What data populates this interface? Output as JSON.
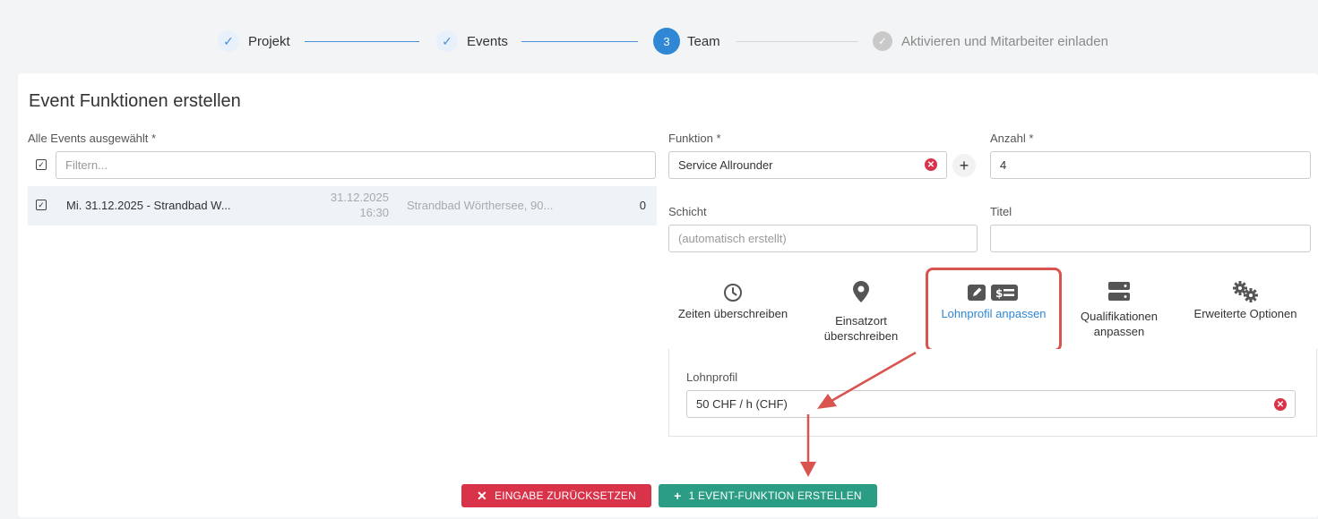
{
  "stepper": {
    "steps": [
      {
        "label": "Projekt",
        "state": "done"
      },
      {
        "label": "Events",
        "state": "done"
      },
      {
        "label": "Team",
        "state": "active",
        "number": "3"
      },
      {
        "label": "Aktivieren und Mitarbeiter einladen",
        "state": "pending"
      }
    ]
  },
  "form": {
    "title": "Event Funktionen erstellen",
    "events_label": "Alle Events ausgewählt *",
    "filter_placeholder": "Filtern...",
    "event_row": {
      "name": "Mi. 31.12.2025 - Strandbad W...",
      "date": "31.12.2025",
      "time": "16:30",
      "location": "Strandbad Wörthersee, 90...",
      "count": "0"
    },
    "funktion_label": "Funktion *",
    "funktion_value": "Service Allrounder",
    "anzahl_label": "Anzahl *",
    "anzahl_value": "4",
    "schicht_label": "Schicht",
    "schicht_placeholder": "(automatisch erstellt)",
    "titel_label": "Titel",
    "titel_value": ""
  },
  "tabs": [
    {
      "line1": "Zeiten überschreiben",
      "line2": "",
      "icon": "clock-icon"
    },
    {
      "line1": "Einsatzort",
      "line2": "überschreiben",
      "icon": "map-pin-icon"
    },
    {
      "line1": "Lohnprofil anpassen",
      "line2": "",
      "icon": "edit-money-icon"
    },
    {
      "line1": "Qualifikationen",
      "line2": "anpassen",
      "icon": "server-icon"
    },
    {
      "line1": "Erweiterte Optionen",
      "line2": "",
      "icon": "gears-icon"
    }
  ],
  "lohnprofil": {
    "label": "Lohnprofil",
    "value": "50 CHF / h (CHF)"
  },
  "buttons": {
    "reset": "EINGABE ZURÜCKSETZEN",
    "create": "1 EVENT-FUNKTION ERSTELLEN"
  },
  "colors": {
    "primary": "#2f87d6",
    "danger": "#d9334a",
    "success": "#2a9d84",
    "annotation": "#d9534f"
  }
}
